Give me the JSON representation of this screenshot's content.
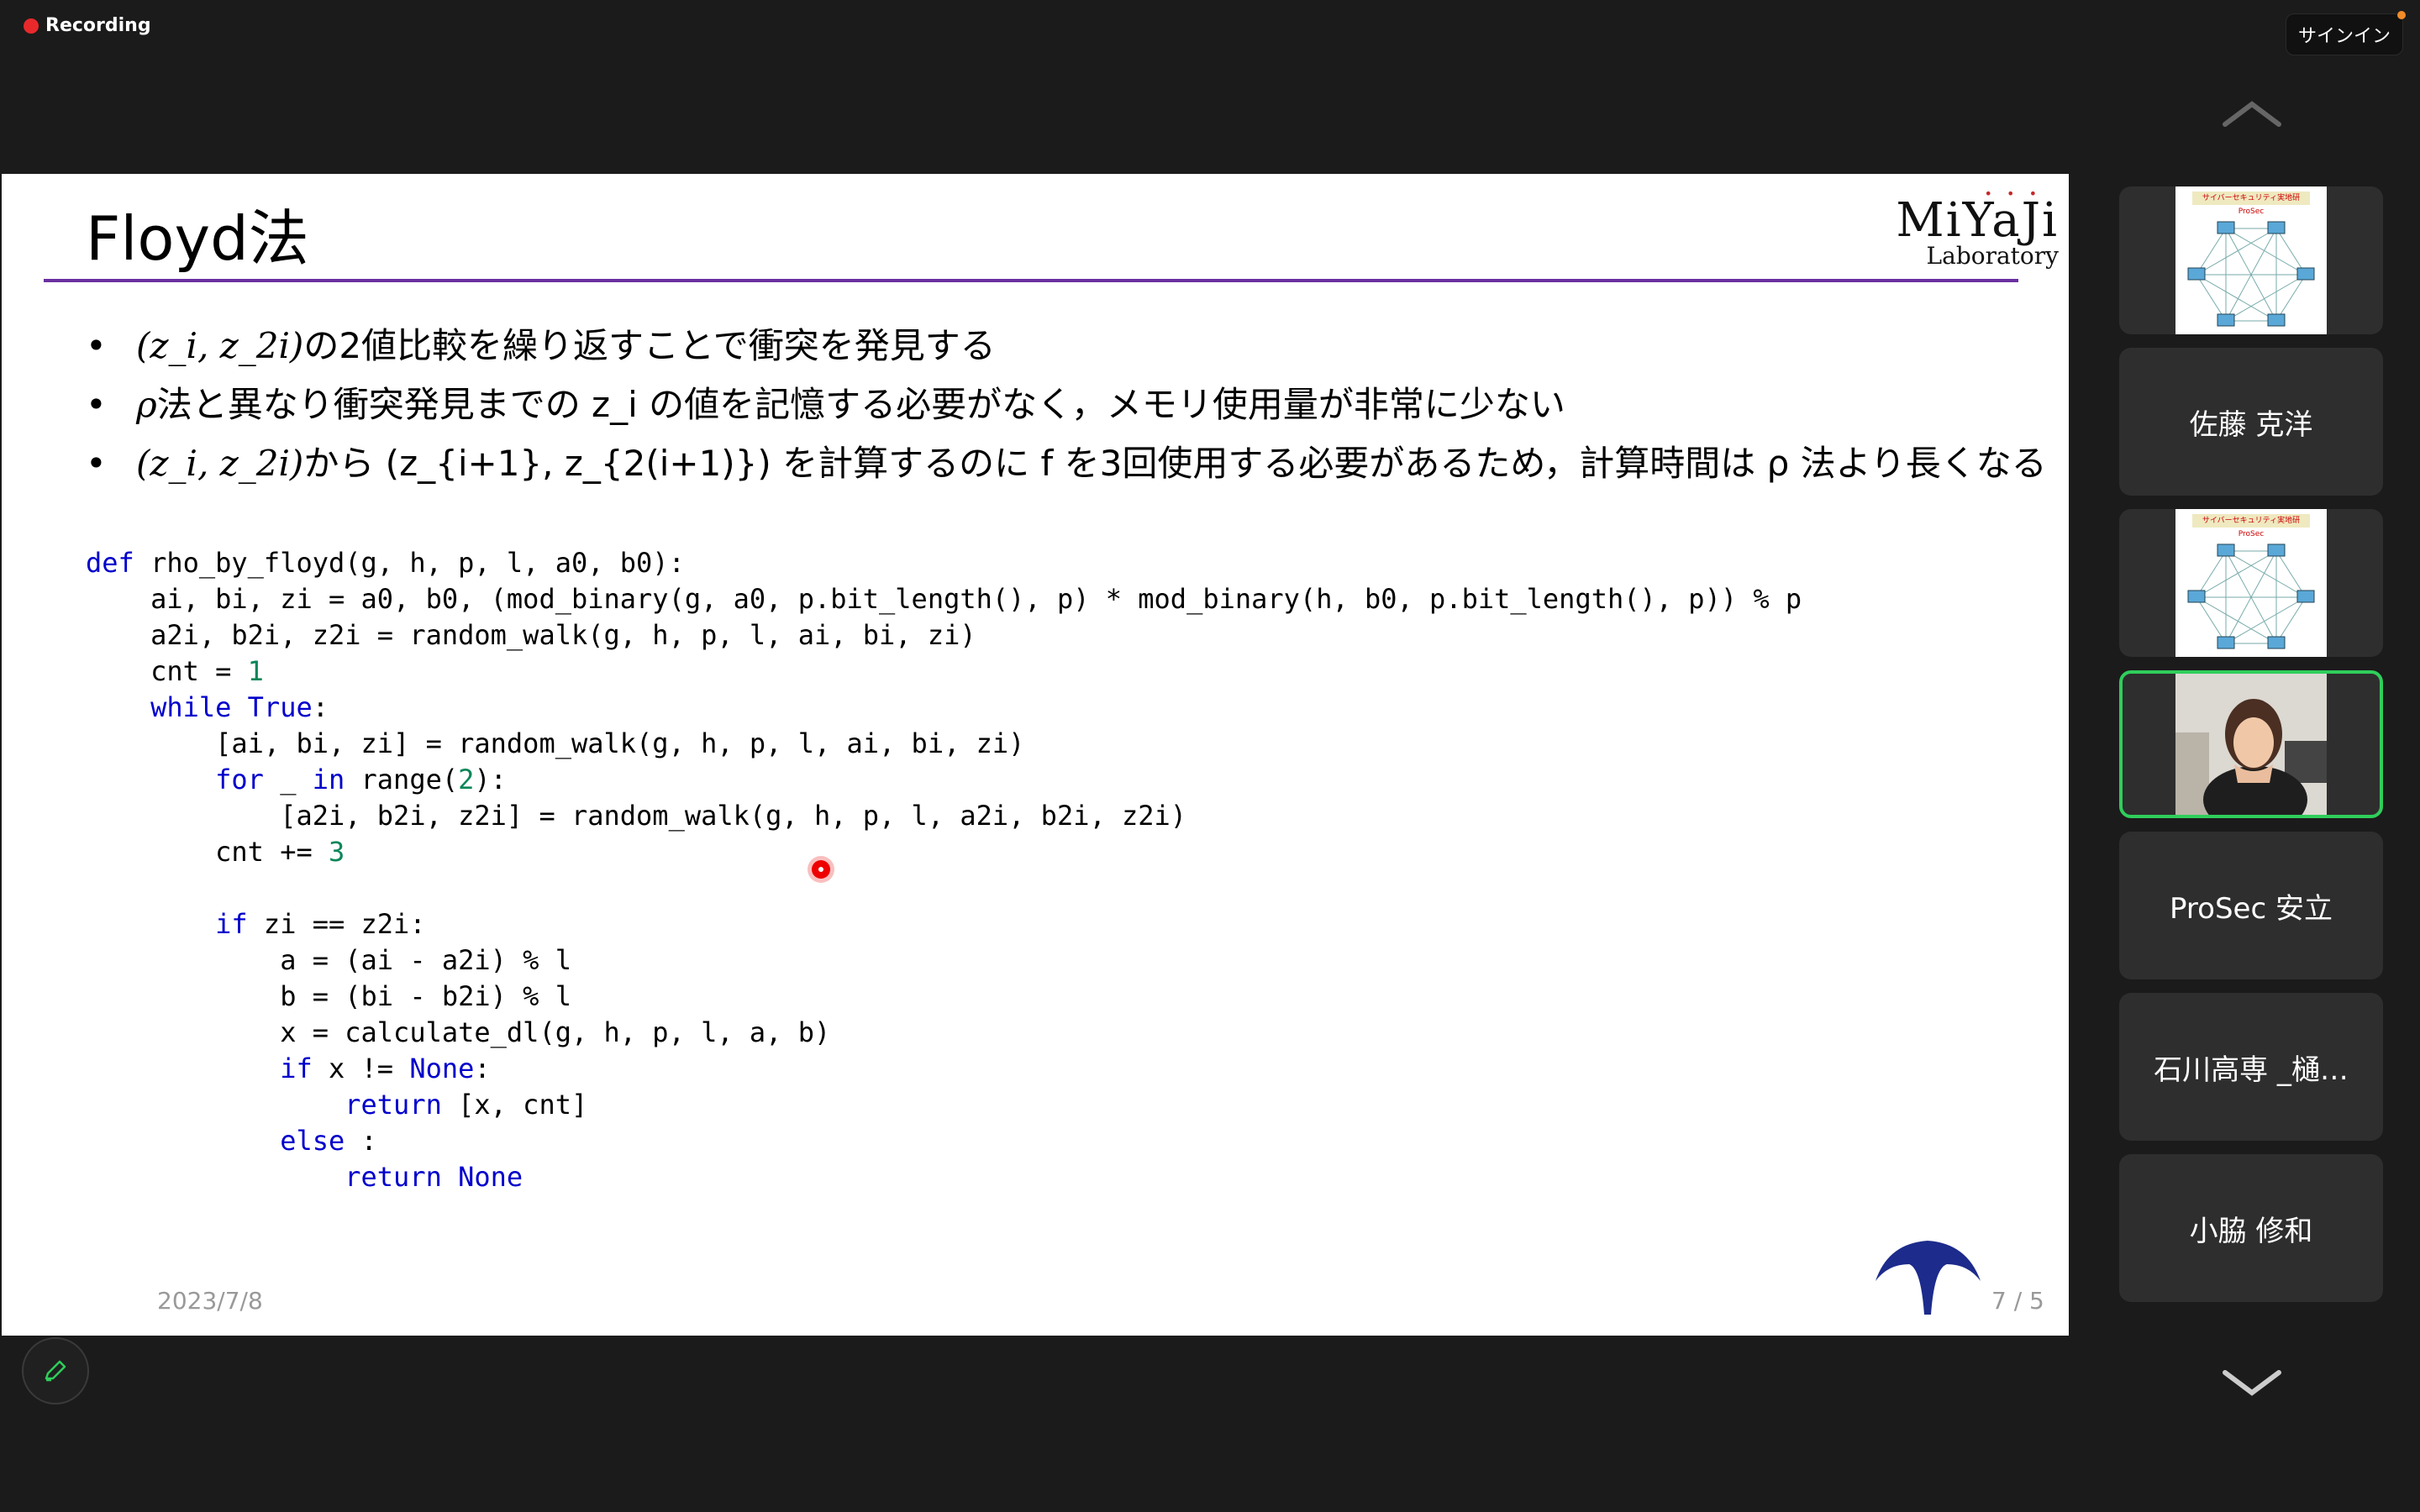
{
  "recording": {
    "label": "Recording"
  },
  "signin": {
    "label": "サインイン"
  },
  "slide": {
    "title": "Floyd法",
    "logo": {
      "line1": "MiYaJi",
      "line2": "Laboratory"
    },
    "bullets": [
      {
        "math_pre": "(z_i, z_2i)",
        "text": " の2値比較を繰り返すことで衝突を発見する"
      },
      {
        "math_pre": "ρ",
        "text": " 法と異なり衝突発見までの z_i の値を記憶する必要がなく，メモリ使用量が非常に少ない"
      },
      {
        "math_pre": "(z_i, z_2i)",
        "text": " から (z_{i+1}, z_{2(i+1)}) を計算するのに f を3回使用する必要があるため，計算時間は ρ 法より長くなる"
      }
    ],
    "code": [
      "def rho_by_floyd(g, h, p, l, a0, b0):",
      "    ai, bi, zi = a0, b0, (mod_binary(g, a0, p.bit_length(), p) * mod_binary(h, b0, p.bit_length(), p)) % p",
      "    a2i, b2i, z2i = random_walk(g, h, p, l, ai, bi, zi)",
      "    cnt = 1",
      "    while True:",
      "        [ai, bi, zi] = random_walk(g, h, p, l, ai, bi, zi)",
      "        for _ in range(2):",
      "            [a2i, b2i, z2i] = random_walk(g, h, p, l, a2i, b2i, z2i)",
      "        cnt += 3",
      "",
      "        if zi == z2i:",
      "            a = (ai - a2i) % l",
      "            b = (bi - b2i) % l",
      "            x = calculate_dl(g, h, p, l, a, b)",
      "            if x != None:",
      "                return [x, cnt]",
      "            else :",
      "                return None"
    ],
    "date": "2023/7/8",
    "page": "7 / 5"
  },
  "participants": [
    {
      "name": "",
      "kind": "slide-thumb"
    },
    {
      "name": "佐藤 克洋",
      "kind": "name"
    },
    {
      "name": "",
      "kind": "slide-thumb"
    },
    {
      "name": "",
      "kind": "video"
    },
    {
      "name": "ProSec 安立",
      "kind": "name"
    },
    {
      "name": "石川高専 _樋…",
      "kind": "name"
    },
    {
      "name": "小脇 修和",
      "kind": "name"
    }
  ],
  "thumb_header": "サイバーセキュリティ実地研 ProSec",
  "colors": {
    "active_border": "#2fce5b",
    "title_rule": "#6a2fa0",
    "recording": "#e8292c"
  }
}
